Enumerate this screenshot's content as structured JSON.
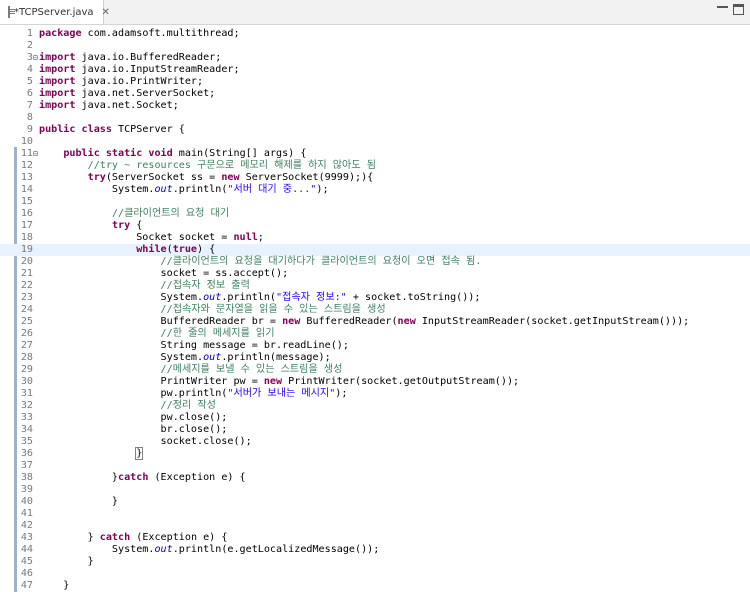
{
  "tab": {
    "title": "*TCPServer.java",
    "close": "✕"
  },
  "lines": [
    {
      "n": "1",
      "t": [
        [
          "k",
          "package"
        ],
        [
          "",
          "com.adamsoft.multithread;"
        ]
      ]
    },
    {
      "n": "2",
      "t": []
    },
    {
      "n": "3",
      "fold": "⊟",
      "t": [
        [
          "k",
          "import"
        ],
        [
          "",
          "java.io.BufferedReader;"
        ]
      ]
    },
    {
      "n": "4",
      "t": [
        [
          "k",
          "import"
        ],
        [
          "",
          "java.io.InputStreamReader;"
        ]
      ]
    },
    {
      "n": "5",
      "t": [
        [
          "k",
          "import"
        ],
        [
          "",
          "java.io.PrintWriter;"
        ]
      ]
    },
    {
      "n": "6",
      "t": [
        [
          "k",
          "import"
        ],
        [
          "",
          "java.net.ServerSocket;"
        ]
      ]
    },
    {
      "n": "7",
      "t": [
        [
          "k",
          "import"
        ],
        [
          "",
          "java.net.Socket;"
        ]
      ]
    },
    {
      "n": "8",
      "t": []
    },
    {
      "n": "9",
      "t": [
        [
          "k",
          "public"
        ],
        [
          "",
          " "
        ],
        [
          "k",
          "class"
        ],
        [
          "",
          " TCPServer {"
        ]
      ]
    },
    {
      "n": "10",
      "t": []
    },
    {
      "n": "11",
      "fold": "⊟",
      "t": [
        [
          "",
          "    "
        ],
        [
          "k",
          "public"
        ],
        [
          "",
          " "
        ],
        [
          "k",
          "static"
        ],
        [
          "",
          " "
        ],
        [
          "k",
          "void"
        ],
        [
          "",
          " main(String[] args) {"
        ]
      ]
    },
    {
      "n": "12",
      "t": [
        [
          "",
          "        "
        ],
        [
          "c",
          "//try ~ resources 구문으로 메모리 해제를 하지 않아도 됨"
        ]
      ]
    },
    {
      "n": "13",
      "t": [
        [
          "",
          "        "
        ],
        [
          "k",
          "try"
        ],
        [
          "",
          "(ServerSocket ss = "
        ],
        [
          "k",
          "new"
        ],
        [
          "",
          " ServerSocket(9999);){"
        ]
      ]
    },
    {
      "n": "14",
      "t": [
        [
          "",
          "            System."
        ],
        [
          "st",
          "out"
        ],
        [
          "",
          ".println("
        ],
        [
          "s",
          "\"서버 대기 중...\""
        ],
        [
          "",
          ");"
        ]
      ]
    },
    {
      "n": "15",
      "t": []
    },
    {
      "n": "16",
      "t": [
        [
          "",
          "            "
        ],
        [
          "c",
          "//클라이언트의 요청 대기"
        ]
      ]
    },
    {
      "n": "17",
      "t": [
        [
          "",
          "            "
        ],
        [
          "k",
          "try"
        ],
        [
          "",
          " {"
        ]
      ]
    },
    {
      "n": "18",
      "t": [
        [
          "",
          "                Socket socket = "
        ],
        [
          "k",
          "null"
        ],
        [
          "",
          ";"
        ]
      ]
    },
    {
      "n": "19",
      "hl": true,
      "t": [
        [
          "",
          "                "
        ],
        [
          "k",
          "while"
        ],
        [
          "",
          "("
        ],
        [
          "k",
          "true"
        ],
        [
          "",
          ") {"
        ]
      ]
    },
    {
      "n": "20",
      "t": [
        [
          "",
          "                    "
        ],
        [
          "c",
          "//클라이언트의 요청을 대기하다가 클라이언트의 요청이 오면 접속 됨."
        ]
      ]
    },
    {
      "n": "21",
      "t": [
        [
          "",
          "                    socket = ss.accept();"
        ]
      ]
    },
    {
      "n": "22",
      "t": [
        [
          "",
          "                    "
        ],
        [
          "c",
          "//접속자 정보 출력"
        ]
      ]
    },
    {
      "n": "23",
      "t": [
        [
          "",
          "                    System."
        ],
        [
          "st",
          "out"
        ],
        [
          "",
          ".println("
        ],
        [
          "s",
          "\"접속자 정보:\""
        ],
        [
          "",
          " + socket.toString());"
        ]
      ]
    },
    {
      "n": "24",
      "t": [
        [
          "",
          "                    "
        ],
        [
          "c",
          "//접속자와 문자열을 읽을 수 있는 스트림을 생성"
        ]
      ]
    },
    {
      "n": "25",
      "t": [
        [
          "",
          "                    BufferedReader br = "
        ],
        [
          "k",
          "new"
        ],
        [
          "",
          " BufferedReader("
        ],
        [
          "k",
          "new"
        ],
        [
          "",
          " InputStreamReader(socket.getInputStream()));"
        ]
      ]
    },
    {
      "n": "26",
      "t": [
        [
          "",
          "                    "
        ],
        [
          "c",
          "//한 줄의 메세지를 읽기"
        ]
      ]
    },
    {
      "n": "27",
      "t": [
        [
          "",
          "                    String message = br.readLine();"
        ]
      ]
    },
    {
      "n": "28",
      "t": [
        [
          "",
          "                    System."
        ],
        [
          "st",
          "out"
        ],
        [
          "",
          ".println(message);"
        ]
      ]
    },
    {
      "n": "29",
      "t": [
        [
          "",
          "                    "
        ],
        [
          "c",
          "//메세지를 보낼 수 있는 스트림을 생성"
        ]
      ]
    },
    {
      "n": "30",
      "t": [
        [
          "",
          "                    PrintWriter pw = "
        ],
        [
          "k",
          "new"
        ],
        [
          "",
          " PrintWriter(socket.getOutputStream());"
        ]
      ]
    },
    {
      "n": "31",
      "t": [
        [
          "",
          "                    pw.println("
        ],
        [
          "s",
          "\"서버가 보내는 메시지\""
        ],
        [
          "",
          ");"
        ]
      ]
    },
    {
      "n": "32",
      "t": [
        [
          "",
          "                    "
        ],
        [
          "c",
          "//정리 작성"
        ]
      ]
    },
    {
      "n": "33",
      "t": [
        [
          "",
          "                    pw.close();"
        ]
      ]
    },
    {
      "n": "34",
      "t": [
        [
          "",
          "                    br.close();"
        ]
      ]
    },
    {
      "n": "35",
      "t": [
        [
          "",
          "                    socket.close();"
        ]
      ]
    },
    {
      "n": "36",
      "t": [
        [
          "",
          "                "
        ],
        [
          "bbox",
          "}"
        ]
      ]
    },
    {
      "n": "37",
      "t": []
    },
    {
      "n": "38",
      "t": [
        [
          "",
          "            }"
        ],
        [
          "k",
          "catch"
        ],
        [
          "",
          " (Exception e) {"
        ]
      ]
    },
    {
      "n": "39",
      "t": []
    },
    {
      "n": "40",
      "t": [
        [
          "",
          "            }"
        ]
      ]
    },
    {
      "n": "41",
      "t": []
    },
    {
      "n": "42",
      "t": []
    },
    {
      "n": "43",
      "t": [
        [
          "",
          "        } "
        ],
        [
          "k",
          "catch"
        ],
        [
          "",
          " (Exception e) {"
        ]
      ]
    },
    {
      "n": "44",
      "t": [
        [
          "",
          "            System."
        ],
        [
          "st",
          "out"
        ],
        [
          "",
          ".println(e.getLocalizedMessage());"
        ]
      ]
    },
    {
      "n": "45",
      "t": [
        [
          "",
          "        }"
        ]
      ]
    },
    {
      "n": "46",
      "t": []
    },
    {
      "n": "47",
      "t": [
        [
          "",
          "    }"
        ]
      ]
    }
  ]
}
